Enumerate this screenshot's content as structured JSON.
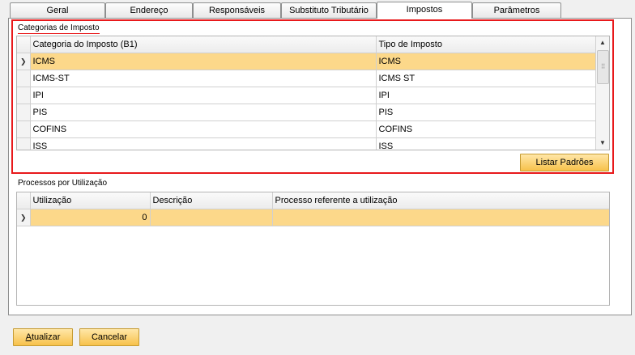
{
  "tabs": [
    {
      "label": "Geral"
    },
    {
      "label": "Endereço"
    },
    {
      "label": "Responsáveis"
    },
    {
      "label": "Substituto Tributário"
    },
    {
      "label": "Impostos"
    },
    {
      "label": "Parâmetros"
    }
  ],
  "tax_categories": {
    "title": "Categorias de Imposto",
    "columns": [
      "Categoria do Imposto (B1)",
      "Tipo de Imposto"
    ],
    "rows": [
      {
        "category": "ICMS",
        "type": "ICMS"
      },
      {
        "category": "ICMS-ST",
        "type": "ICMS ST"
      },
      {
        "category": "IPI",
        "type": "IPI"
      },
      {
        "category": "PIS",
        "type": "PIS"
      },
      {
        "category": "COFINS",
        "type": "COFINS"
      },
      {
        "category": "ISS",
        "type": "ISS"
      }
    ],
    "list_defaults_button": "Listar Padrões"
  },
  "usage_processes": {
    "title": "Processos por Utilização",
    "columns": [
      "Utilização",
      "Descrição",
      "Processo referente a utilização"
    ],
    "rows": [
      {
        "usage": "0",
        "description": "",
        "process": ""
      }
    ]
  },
  "footer": {
    "update_button_first": "A",
    "update_button_rest": "tualizar",
    "cancel_button": "Cancelar"
  },
  "colors": {
    "selected_row": "#fcd88a",
    "button": "#f7c14b",
    "highlight_frame": "#e8191b"
  }
}
